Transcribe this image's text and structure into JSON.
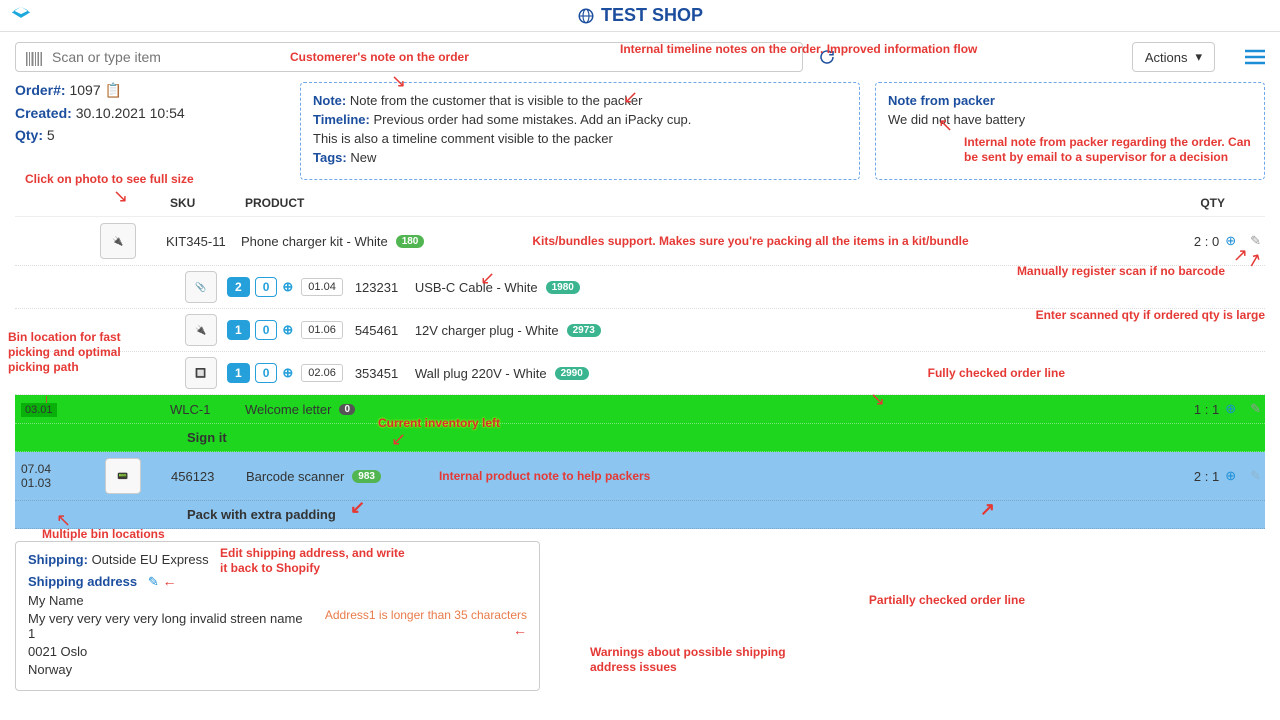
{
  "header": {
    "shop_title": "TEST SHOP"
  },
  "toolbar": {
    "scan_placeholder": "Scan or type item",
    "actions_label": "Actions"
  },
  "order": {
    "number_label": "Order#:",
    "number": "1097",
    "created_label": "Created:",
    "created": "30.10.2021 10:54",
    "qty_label": "Qty:",
    "qty": "5"
  },
  "notes": {
    "note_label": "Note:",
    "note_text": "Note from the customer that is visible to the packer",
    "timeline_label": "Timeline:",
    "timeline1": "Previous order had some mistakes. Add an iPacky cup.",
    "timeline2": "This is also a timeline comment visible to the packer",
    "tags_label": "Tags:",
    "tags": "New"
  },
  "packer_note": {
    "title": "Note from packer",
    "text": "We did not have battery"
  },
  "columns": {
    "sku": "SKU",
    "product": "PRODUCT",
    "qty": "QTY"
  },
  "lines": [
    {
      "sku": "KIT345-11",
      "name": "Phone charger kit - White",
      "stock": "180",
      "qty": "2 : 0"
    },
    {
      "chips": [
        "2",
        "0"
      ],
      "bin": "01.04",
      "sku": "123231",
      "name": "USB-C Cable - White",
      "stock": "1980"
    },
    {
      "chips": [
        "1",
        "0"
      ],
      "bin": "01.06",
      "sku": "545461",
      "name": "12V charger plug - White",
      "stock": "2973"
    },
    {
      "chips": [
        "1",
        "0"
      ],
      "bin": "02.06",
      "sku": "353451",
      "name": "Wall plug 220V - White",
      "stock": "2990"
    },
    {
      "bins": "03.01",
      "sku": "WLC-1",
      "name": "Welcome letter",
      "stock": "0",
      "qty": "1 : 1",
      "note": "Sign it"
    },
    {
      "bins": [
        "07.04",
        "01.03"
      ],
      "sku": "456123",
      "name": "Barcode scanner",
      "stock": "983",
      "qty": "2 : 1",
      "note": "Pack with extra padding"
    }
  ],
  "shipping": {
    "label": "Shipping:",
    "method": "Outside EU Express",
    "addr_title": "Shipping address",
    "name": "My Name",
    "line1": "My very very very very long invalid streen name 1",
    "postal": "0021  Oslo",
    "country": "Norway",
    "warning": "Address1 is longer than 35 characters"
  },
  "annotations": {
    "cust_note": "Customerer's note on the order",
    "timeline_note": "Internal timeline notes on the order. Improved information flow",
    "packer_internal": "Internal note from packer regarding the order. Can be sent by email to a supervisor for a decision",
    "click_photo": "Click on photo to see full size",
    "kits": "Kits/bundles support. Makes sure you're packing all the items in a kit/bundle",
    "manual_scan": "Manually register scan if no barcode",
    "enter_qty": "Enter scanned qty if ordered qty is large",
    "bin_loc": "Bin location for fast picking and optimal picking path",
    "fully_checked": "Fully checked order line",
    "inventory": "Current inventory left",
    "prod_note": "Internal product note to help packers",
    "multi_bin": "Multiple bin locations",
    "partial": "Partially checked order line",
    "edit_ship": "Edit shipping address, and write it back to Shopify",
    "warn_ship": "Warnings about possible shipping address issues"
  }
}
